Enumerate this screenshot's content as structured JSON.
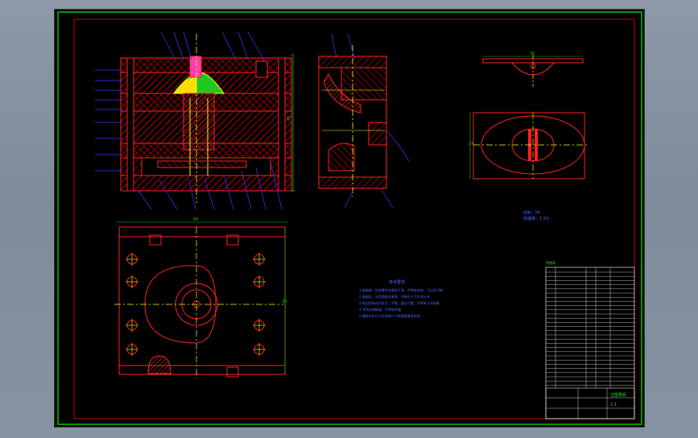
{
  "drawing": {
    "dim_top_view": "36",
    "dim_plan_width": "80",
    "dim_side_right": "45",
    "dim_part_top": "36",
    "dim_part_left": "24",
    "material_line1": "材料：PP",
    "material_line2": "收缩率：1.5%",
    "tech_title": "技术要求",
    "tech_notes": [
      "1.装配前，所有零件须清洗干净，不得有毛刺、飞边及污物",
      "2.装配后，分型面贴合紧密，间隙不大于0.02mm",
      "3.推出机构动作灵活、平稳，复位可靠，不得有卡滞现象",
      "4.冷却水道畅通，不得有渗漏",
      "5.模具外形尺寸及安装尺寸按图纸要求检验"
    ],
    "bom_header": "明细表",
    "title_block_name": "注塑模具",
    "title_block_scale": "1:1"
  },
  "colors": {
    "frame": "#00c800",
    "inner_frame": "#c80000",
    "lines": "#ff2020",
    "hatch": "#d00000",
    "center": "#ffff00",
    "leader": "#3b3bff",
    "text_green": "#22dd22",
    "text_blue": "#4a6bff",
    "part_fill": "#ffdc00",
    "part_fill2": "#22c822"
  }
}
